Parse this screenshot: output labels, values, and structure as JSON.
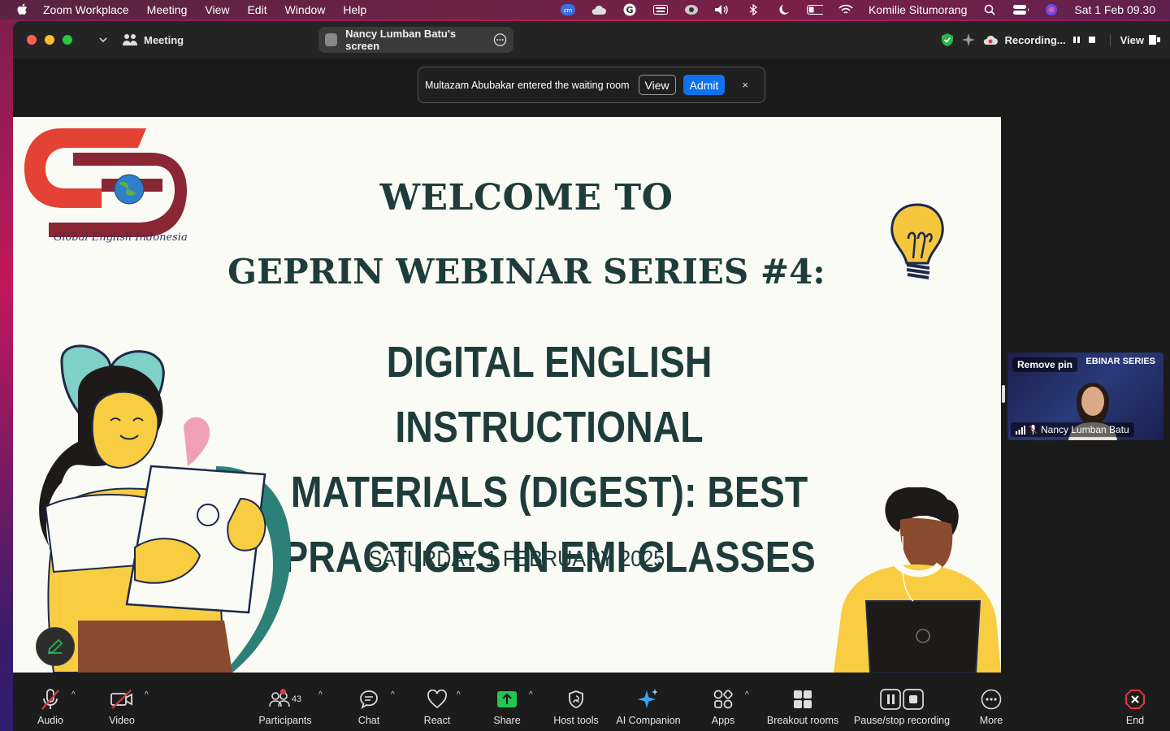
{
  "menubar": {
    "app_name": "Zoom Workplace",
    "items": [
      "Meeting",
      "View",
      "Edit",
      "Window",
      "Help"
    ],
    "user": "Komilie Situmorang",
    "datetime": "Sat 1 Feb  09.30"
  },
  "window": {
    "meeting_label": "Meeting",
    "screen_share_label": "Nancy Lumban Batu's screen",
    "recording_label": "Recording...",
    "view_label": "View"
  },
  "banner": {
    "message": "Multazam Abubakar entered the waiting room",
    "view_label": "View",
    "admit_label": "Admit",
    "close_label": "×",
    "admit_color": "#0e72ed"
  },
  "slide": {
    "welcome": "WELCOME TO",
    "series": "GEPRIN WEBINAR SERIES #4:",
    "topic_lines": [
      "DIGITAL ENGLISH INSTRUCTIONAL",
      "MATERIALS (DIGEST): BEST",
      "PRACTICES IN EMI CLASSES"
    ],
    "date": "SATURDAY, 1 FEBRUARY 2025",
    "logo_text": "Global English Indonesia",
    "text_color": "#1e3d3a",
    "background": "#fbfbf6"
  },
  "thumbnail": {
    "remove_pin": "Remove pin",
    "background_title": "EBINAR SERIES",
    "name": "Nancy Lumban Batu"
  },
  "toolbar": {
    "audio": "Audio",
    "video": "Video",
    "participants": "Participants",
    "participant_count": "43",
    "chat": "Chat",
    "react": "React",
    "share": "Share",
    "host_tools": "Host tools",
    "ai_companion": "AI Companion",
    "apps": "Apps",
    "breakout_rooms": "Breakout rooms",
    "recording": "Pause/stop recording",
    "more": "More",
    "end": "End",
    "share_color": "#23c552",
    "end_color": "#e0393e"
  }
}
